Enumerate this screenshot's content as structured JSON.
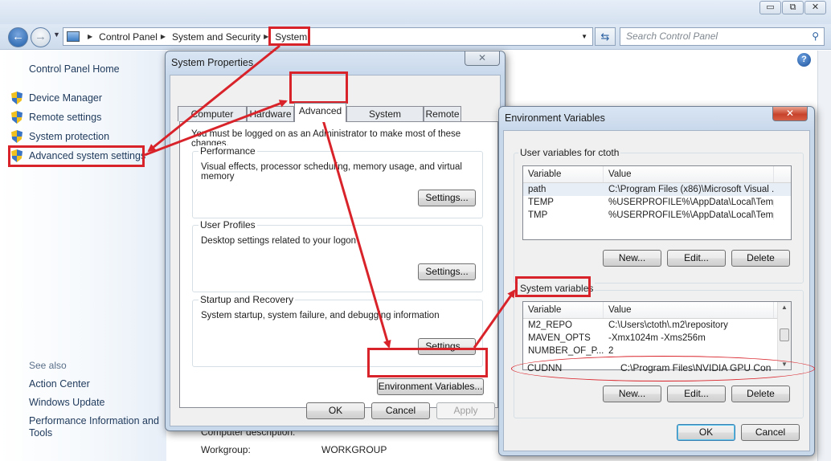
{
  "explorer": {
    "window_controls": [
      "▭",
      "⧉",
      "✕"
    ],
    "breadcrumb": [
      "Control Panel",
      "System and Security",
      "System"
    ],
    "search_placeholder": "Search Control Panel",
    "help_glyph": "?"
  },
  "left_pane": {
    "home": "Control Panel Home",
    "tasks": [
      "Device Manager",
      "Remote settings",
      "System protection",
      "Advanced system settings"
    ],
    "see_also_heading": "See also",
    "see_also": [
      "Action Center",
      "Windows Update",
      "Performance Information and Tools"
    ]
  },
  "background": {
    "computer_description": "Computer description:",
    "workgroup_label": "Workgroup:",
    "workgroup_value": "WORKGROUP"
  },
  "system_properties": {
    "title": "System Properties",
    "close": "✕",
    "tabs": [
      "Computer Name",
      "Hardware",
      "Advanced",
      "System Protection",
      "Remote"
    ],
    "active_tab": "Advanced",
    "admin_note": "You must be logged on as an Administrator to make most of these changes.",
    "groups": [
      {
        "label": "Performance",
        "desc": "Visual effects, processor scheduling, memory usage, and virtual memory",
        "button": "Settings..."
      },
      {
        "label": "User Profiles",
        "desc": "Desktop settings related to your logon",
        "button": "Settings..."
      },
      {
        "label": "Startup and Recovery",
        "desc": "System startup, system failure, and debugging information",
        "button": "Settings..."
      }
    ],
    "env_button": "Environment Variables...",
    "ok": "OK",
    "cancel": "Cancel",
    "apply": "Apply"
  },
  "env_vars": {
    "title": "Environment Variables",
    "close": "✕",
    "user_label": "User variables for ctoth",
    "col_variable": "Variable",
    "col_value": "Value",
    "user_rows": [
      {
        "name": "path",
        "value": "C:\\Program Files (x86)\\Microsoft Visual ..."
      },
      {
        "name": "TEMP",
        "value": "%USERPROFILE%\\AppData\\Local\\Temp"
      },
      {
        "name": "TMP",
        "value": "%USERPROFILE%\\AppData\\Local\\Temp"
      }
    ],
    "new_btn": "New...",
    "edit_btn": "Edit...",
    "delete_btn": "Delete",
    "system_label": "System variables",
    "system_rows": [
      {
        "name": "M2_REPO",
        "value": "C:\\Users\\ctoth\\.m2\\repository"
      },
      {
        "name": "MAVEN_OPTS",
        "value": "-Xmx1024m -Xms256m"
      },
      {
        "name": "NUMBER_OF_P...",
        "value": "2"
      }
    ],
    "cudnn_row": {
      "name": "CUDNN",
      "value": "C:\\Program Files\\NVIDIA GPU Con"
    },
    "ok": "OK",
    "cancel": "Cancel"
  },
  "colors": {
    "highlight": "#d9232a",
    "link": "#1e395b",
    "dialog_frame": "#c8d8eb"
  }
}
